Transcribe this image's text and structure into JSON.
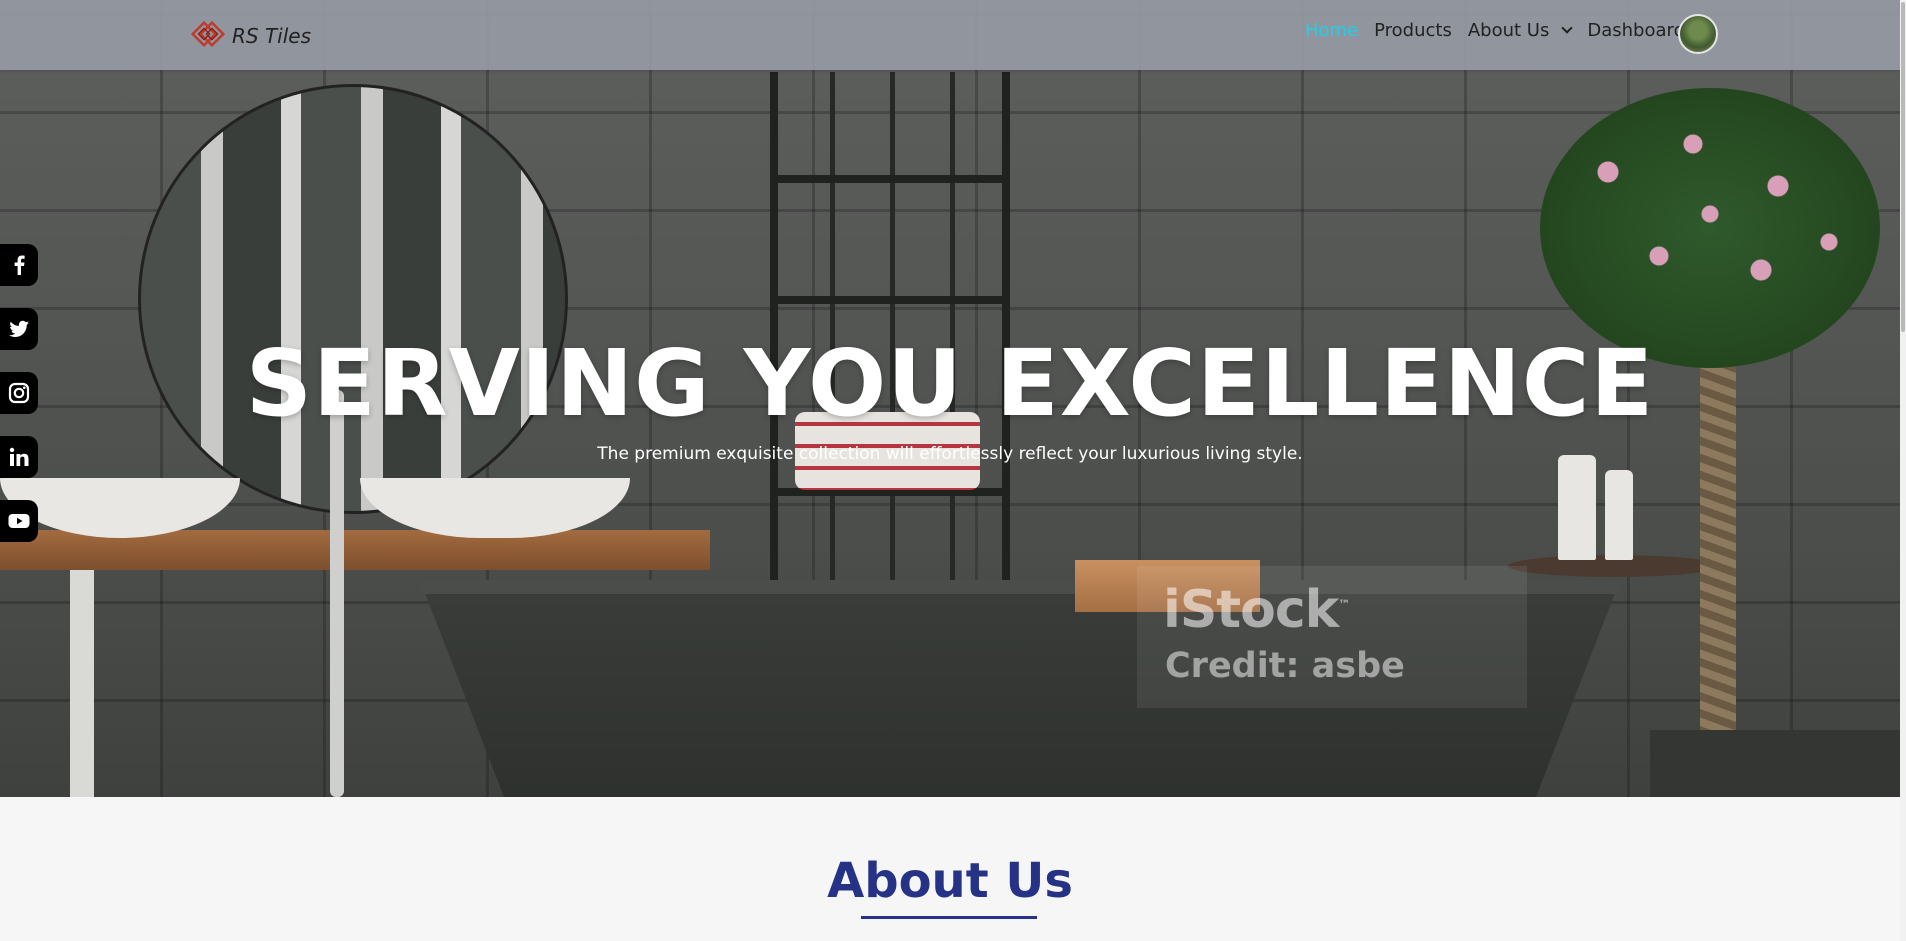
{
  "brand": {
    "name": "RS Tiles"
  },
  "nav": {
    "items": [
      {
        "label": "Home",
        "active": true
      },
      {
        "label": "Products",
        "active": false
      },
      {
        "label": "About Us",
        "active": false,
        "dropdown": true
      },
      {
        "label": "Dashboard",
        "active": false
      }
    ],
    "active_color": "#20d0e8"
  },
  "hero": {
    "title": "SERVING YOU EXCELLENCE",
    "subtitle": "The premium exquisite collection will effortlessly reflect your luxurious living style.",
    "watermark": {
      "brand": "iStock",
      "trademark": "™",
      "credit": "Credit: asbe"
    }
  },
  "social": {
    "icons": [
      "facebook-icon",
      "twitter-icon",
      "instagram-icon",
      "linkedin-icon",
      "youtube-icon"
    ]
  },
  "about": {
    "title": "About Us",
    "title_color": "#263286"
  },
  "colors": {
    "navbar": "#969aa4",
    "about_bg": "#f6f6f7"
  }
}
